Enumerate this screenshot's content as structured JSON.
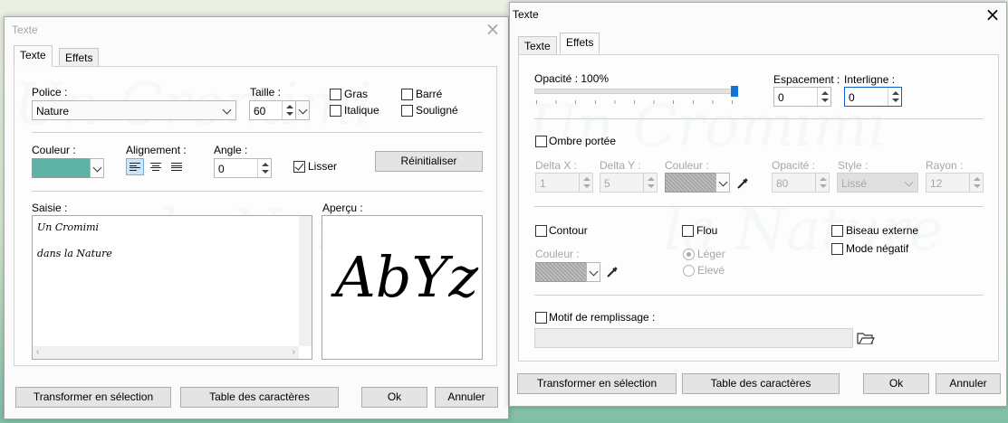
{
  "window_left": {
    "title": "Texte",
    "tabs": [
      "Texte",
      "Effets"
    ],
    "police_label": "Police :",
    "police_value": "Nature",
    "taille_label": "Taille :",
    "taille_value": "60",
    "styles": {
      "gras": "Gras",
      "barre": "Barré",
      "italique": "Italique",
      "souligne": "Souligné"
    },
    "couleur_label": "Couleur :",
    "couleur_color": "#5fb3a4",
    "alignement_label": "Alignement :",
    "angle_label": "Angle :",
    "angle_value": "0",
    "lisser_label": "Lisser",
    "lisser_checked": true,
    "reinitialiser_button": "Réinitialiser",
    "saisie_label": "Saisie :",
    "saisie_lines": [
      "Un Cromimi",
      "dans la Nature"
    ],
    "apercu_label": "Aperçu :",
    "apercu_text": "AbYz",
    "buttons": {
      "transformer": "Transformer en sélection",
      "table": "Table des caractères",
      "ok": "Ok",
      "annuler": "Annuler"
    }
  },
  "window_right": {
    "title": "Texte",
    "tabs": [
      "Texte",
      "Effets"
    ],
    "opacite_label": "Opacité : 100%",
    "opacite_value": 1.0,
    "espacement_label": "Espacement :",
    "espacement_value": "0",
    "interligne_label": "Interligne :",
    "interligne_value": "0",
    "ombre_label": "Ombre portée",
    "delta_x_label": "Delta X :",
    "delta_x_value": "1",
    "delta_y_label": "Delta Y :",
    "delta_y_value": "5",
    "couleur_label": "Couleur :",
    "opacite2_label": "Opacité :",
    "opacite2_value": "80",
    "style_label": "Style :",
    "style_value": "Lissé",
    "rayon_label": "Rayon :",
    "rayon_value": "12",
    "contour_label": "Contour",
    "flou_label": "Flou",
    "biseau_label": "Biseau externe",
    "negatif_label": "Mode négatif",
    "couleur2_label": "Couleur :",
    "leger_label": "Léger",
    "eleve_label": "Elevé",
    "motif_label": "Motif de remplissage :",
    "buttons": {
      "transformer": "Transformer en sélection",
      "table": "Table des caractères",
      "ok": "Ok",
      "annuler": "Annuler"
    }
  }
}
